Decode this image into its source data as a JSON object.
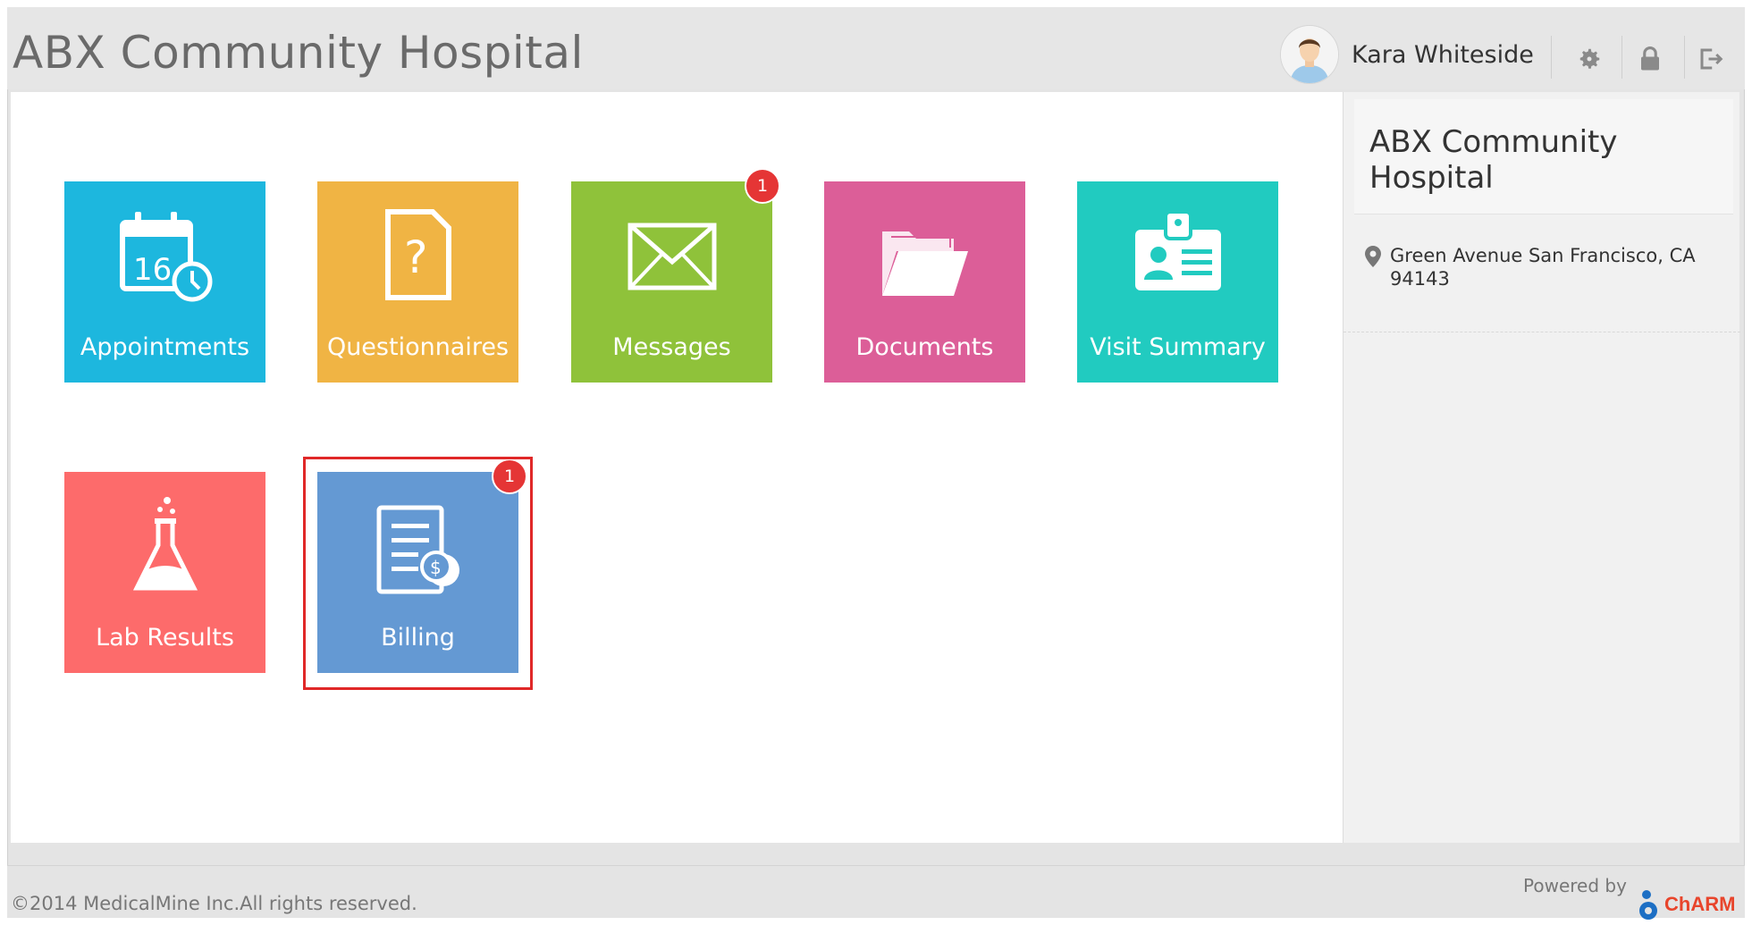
{
  "header": {
    "title": "ABX Community Hospital",
    "user_name": "Kara Whiteside",
    "icons": [
      "gear-icon",
      "lock-icon",
      "logout-icon"
    ]
  },
  "tiles": [
    {
      "label": "Appointments",
      "color": "#1db7de",
      "icon": "calendar-icon",
      "icon_text": "16"
    },
    {
      "label": "Questionnaires",
      "color": "#f0b444",
      "icon": "question-document-icon",
      "icon_text": "?"
    },
    {
      "label": "Messages",
      "color": "#8fc23a",
      "icon": "envelope-icon",
      "badge": "1"
    },
    {
      "label": "Documents",
      "color": "#dc5e98",
      "icon": "folder-icon"
    },
    {
      "label": "Visit Summary",
      "color": "#21cbc0",
      "icon": "id-card-icon"
    },
    {
      "label": "Lab Results",
      "color": "#fd6b6b",
      "icon": "flask-icon"
    },
    {
      "label": "Billing",
      "color": "#6499d3",
      "icon": "bill-icon",
      "badge": "1",
      "highlighted": true
    }
  ],
  "sidebar": {
    "facility_name": "ABX Community Hospital",
    "address": "Green Avenue San Francisco, CA 94143"
  },
  "footer": {
    "copyright": "©2014 MedicalMine Inc.All rights reserved.",
    "powered_by": "Powered by",
    "brand": "ChARM"
  }
}
